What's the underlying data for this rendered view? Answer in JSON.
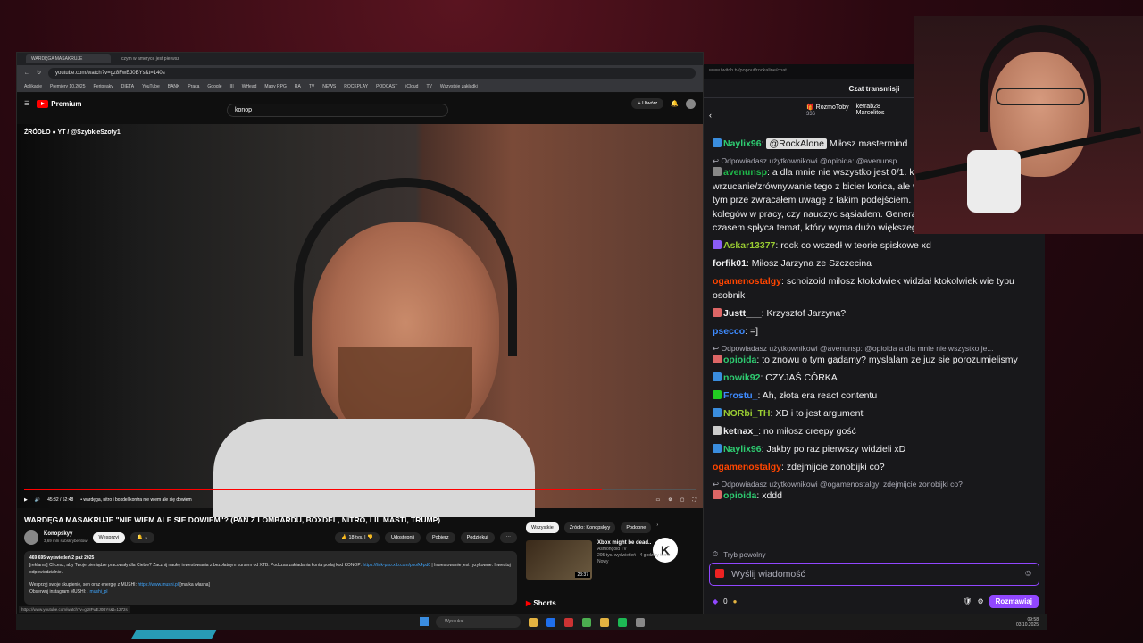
{
  "browser": {
    "tabs": [
      "WARDĘGA MASAKRUJE",
      "czym w ameryce jest pierwsz"
    ],
    "url": "youtube.com/watch?v=gz8FwEJ0BYs&t=140s",
    "bookmarks": [
      "Aplikacje",
      "Premiery 10.2025",
      "Peripeaky",
      "DIETA",
      "YouTube",
      "BANK",
      "Praca",
      "Google",
      "III",
      "WHead",
      "Mapy RPG",
      "RA",
      "TV",
      "NEWS",
      "ROCKPLAY",
      "PODCAST",
      "iCloud",
      "TV",
      "Wszystkie zakładki"
    ]
  },
  "youtube": {
    "logo": "Premium",
    "search_value": "konop",
    "create_label": "Utwórz",
    "source_label": "ŹRÓDŁO  ●  YT / @SzybkieSzoty1",
    "progress": 0.86,
    "time": "45:32 / 52:48",
    "chapter": "• wardęga, nitro i boxdel kontra nie wiem ale się dowiem",
    "title": "WARDĘGA MASAKRUJE \"NIE WIEM ALE SIE DOWIEM\"? (PAN Z LOMBARDU, BOXDEL, NITRO, LIL MASTI, TRUMP)",
    "channel": "Konopskyy",
    "subscribers": "3,69 mln subskrybentów",
    "support_label": "Wesprzyj",
    "likes": "18 tys.",
    "share_label": "Udostępnij",
    "download_label": "Pobierz",
    "thanks_label": "Podziękuj",
    "views": "469 695 wyświetleń  2 paź 2025",
    "desc1": "[reklama] Chcesz, aby Twoje pieniądze pracowały dla Ciebie? Zacznij naukę inwestowania z bezpłatnym kursem od XTB. Podczas zakładania konta podaj kod KONOP:",
    "desc_link1": "https://link-pso.xtb.com/pso/k4pd0",
    "desc2": "| Inwestowanie jest ryzykowne. Inwestuj odpowiedzialnie.",
    "desc3": "Wesprzyj swoje skupienie, sen oraz energię z MUSHI:",
    "desc_link2": "https://www.mushi.pl",
    "desc3b": "[marka własna]",
    "desc4": "Obserwuj instagram MUSHI:",
    "desc4b": "/ mushi_pl",
    "status_url": "https://www.youtube.com/watch?v=gz8FwEJ0BYs&t=1272s",
    "chips": [
      "Wszystkie",
      "Źródło: Konopskyy",
      "Podobne"
    ],
    "rec": {
      "title": "Xbox might be dead..",
      "channel": "Asmongold TV",
      "meta": "205 tys. wyświetleń · 4 godziny temu",
      "badge": "Nowy",
      "duration": "23:37"
    },
    "shorts": "Shorts"
  },
  "taskbar": {
    "search": "Wyszukaj",
    "time": "09:58",
    "date": "03.10.2025"
  },
  "chat": {
    "url": "www.twitch.tv/popout/rockaline/chat",
    "header": "Czat transmisji",
    "gifter1": "RozmoToby",
    "gifter1_count": "336",
    "gifter2": "ketrab28",
    "gifter3": "Marcelitos",
    "messages": [
      {
        "type": "msg",
        "user": "Naylix96",
        "color": "#2ecc71",
        "badge": "#3a8dde",
        "mention": "@RockAlone",
        "text": " Miłosz mastermind"
      },
      {
        "type": "reply",
        "text": "Odpowiadasz użytkownikowi @opioida: @avenunsp"
      },
      {
        "type": "msg",
        "user": "avenunsp",
        "color": "#1fb84a",
        "badge": "#888",
        "text": "a dla mnie nie wszystko jest 0/1. klapsów i wrzucanie/zrównywanie tego z bicier końca, ale wiem, że są ludzie którzy z tym prze zwracałem uwagę z takim podejściem. Wychov samo co relacja kolegów w pracy, czy nauczyc sąsiadem. Generalizowanie czasem pomaga, a czasem spłyca temat, który wyma dużo większego wysiłku"
      },
      {
        "type": "msg",
        "user": "Askar13377",
        "color": "#9acd32",
        "badge": "#8a5cf6",
        "text": "rock co wszedł w teorie spiskowe xd"
      },
      {
        "type": "msg",
        "user": "forfik01",
        "color": "#efeff1",
        "badge": "",
        "text": "Miłosz Jarzyna ze Szczecina"
      },
      {
        "type": "msg",
        "user": "ogamenostalgy",
        "color": "#ff4500",
        "badge": "",
        "text": "schoizoid milosz ktokolwiek widział ktokolwiek wie typu osobnik"
      },
      {
        "type": "msg",
        "user": "Justt___",
        "color": "#efeff1",
        "badge": "#d66",
        "text": "Krzysztof Jarzyna?"
      },
      {
        "type": "msg",
        "user": "psecco",
        "color": "#3e8bff",
        "badge": "",
        "text": "=]"
      },
      {
        "type": "reply",
        "text": "Odpowiadasz użytkownikowi @avenunsp: @opioida a dla mnie nie wszystko je..."
      },
      {
        "type": "msg",
        "user": "opioida",
        "color": "#2ecc71",
        "badge": "#d66",
        "text": "to znowu o tym gadamy? myslalam ze juz sie porozumielismy"
      },
      {
        "type": "msg",
        "user": "nowik92",
        "color": "#2ecc71",
        "badge": "#3a8dde",
        "text": "CZYJAŚ CÓRKA"
      },
      {
        "type": "msg",
        "user": "Frostu_",
        "color": "#3e8bff",
        "badge": "#2c2",
        "text": "Ah, złota era react contentu"
      },
      {
        "type": "msg",
        "user": "NORbi_TH",
        "color": "#9acd32",
        "badge": "#3a8dde",
        "text": "XD i to jest argument"
      },
      {
        "type": "msg",
        "user": "ketnax_",
        "color": "#efeff1",
        "badge": "#ccc",
        "text": "no miłosz creepy gość"
      },
      {
        "type": "msg",
        "user": "Naylix96",
        "color": "#2ecc71",
        "badge": "#3a8dde",
        "text": "Jakby po raz pierwszy widzieli xD"
      },
      {
        "type": "msg",
        "user": "ogamenostalgy",
        "color": "#ff4500",
        "badge": "",
        "text": "zdejmijcie zonobijki co?"
      },
      {
        "type": "reply",
        "text": "Odpowiadasz użytkownikowi @ogamenostalgy: zdejmijcie zonobijki co?"
      },
      {
        "type": "msg",
        "user": "opioida",
        "color": "#2ecc71",
        "badge": "#d66",
        "text": "xddd"
      }
    ],
    "slow_mode": "Tryb powolny",
    "input_placeholder": "Wyślij wiadomość",
    "points": "0",
    "chat_button": "Rozmawiaj"
  }
}
